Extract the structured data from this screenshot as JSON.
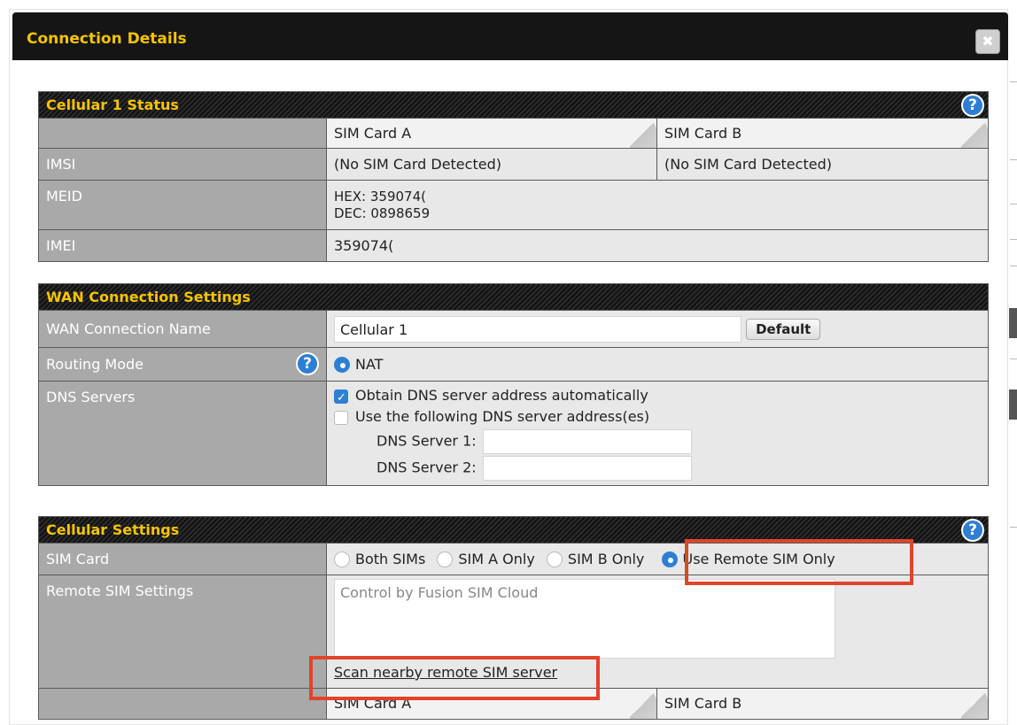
{
  "dialog": {
    "title": "Connection Details",
    "close_label": "✖"
  },
  "status": {
    "header": "Cellular 1 Status",
    "col_a": "SIM Card A",
    "col_b": "SIM Card B",
    "imsi_label": "IMSI",
    "imsi_a": "(No SIM Card Detected)",
    "imsi_b": "(No SIM Card Detected)",
    "meid_label": "MEID",
    "meid_hex": "HEX: 359074(",
    "meid_dec": "DEC: 0898659",
    "imei_label": "IMEI",
    "imei_value": "359074("
  },
  "wan": {
    "header": "WAN Connection Settings",
    "name_label": "WAN Connection Name",
    "name_value": "Cellular 1",
    "default_button": "Default",
    "routing_label": "Routing Mode",
    "routing_value": "NAT",
    "dns_label": "DNS Servers",
    "dns_auto": "Obtain DNS server address automatically",
    "dns_manual": "Use the following DNS server address(es)",
    "dns1_label": "DNS Server 1:",
    "dns2_label": "DNS Server 2:"
  },
  "cellular": {
    "header": "Cellular Settings",
    "sim_label": "SIM Card",
    "opt_both": "Both SIMs",
    "opt_a": "SIM A Only",
    "opt_b": "SIM B Only",
    "opt_remote": "Use Remote SIM Only",
    "remote_label": "Remote SIM Settings",
    "remote_placeholder": "Control by Fusion SIM Cloud",
    "scan_link": "Scan nearby remote SIM server",
    "col_a": "SIM Card A",
    "col_b": "SIM Card B"
  },
  "colors": {
    "accent": "#f5c400",
    "highlight": "#e0442a",
    "radio_on": "#2e7fd3"
  }
}
